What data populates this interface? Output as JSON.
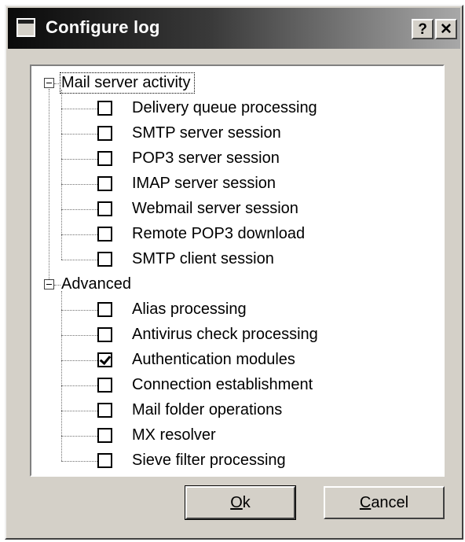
{
  "window": {
    "title": "Configure log",
    "help_label": "?",
    "close_label": "✕"
  },
  "tree": {
    "groups": [
      {
        "label": "Mail server activity",
        "items": [
          {
            "label": "Delivery queue processing",
            "checked": false
          },
          {
            "label": "SMTP server session",
            "checked": false
          },
          {
            "label": "POP3 server session",
            "checked": false
          },
          {
            "label": "IMAP server session",
            "checked": false
          },
          {
            "label": "Webmail server session",
            "checked": false
          },
          {
            "label": "Remote POP3 download",
            "checked": false
          },
          {
            "label": "SMTP client session",
            "checked": false
          }
        ]
      },
      {
        "label": "Advanced",
        "items": [
          {
            "label": "Alias processing",
            "checked": false
          },
          {
            "label": "Antivirus check processing",
            "checked": false
          },
          {
            "label": "Authentication modules",
            "checked": true
          },
          {
            "label": "Connection establishment",
            "checked": false
          },
          {
            "label": "Mail folder operations",
            "checked": false
          },
          {
            "label": "MX resolver",
            "checked": false
          },
          {
            "label": "Sieve filter processing",
            "checked": false
          }
        ]
      }
    ]
  },
  "buttons": {
    "ok_label": "Ok",
    "cancel_label": "Cancel"
  }
}
